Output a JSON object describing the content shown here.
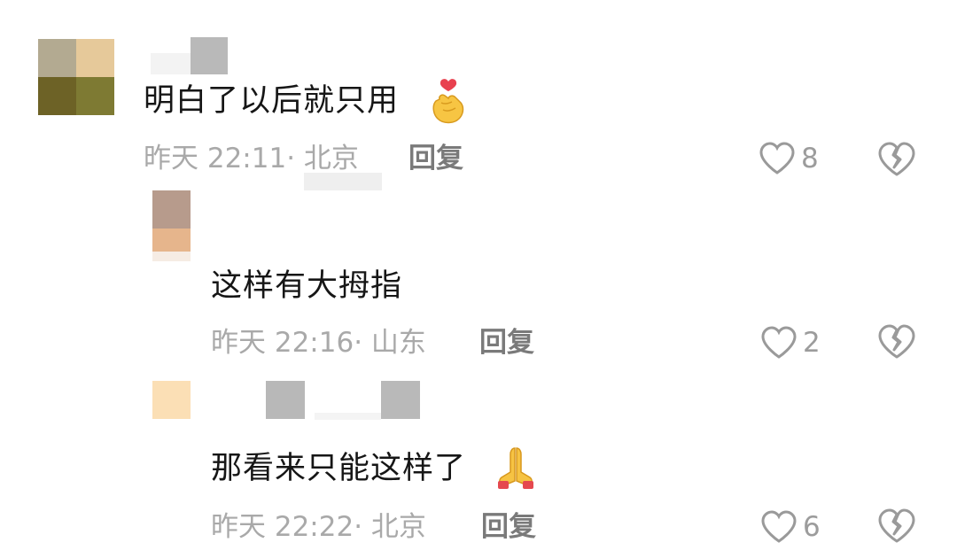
{
  "comments": [
    {
      "text": "明白了以后就只用",
      "emoji_icon": "finger-heart-icon",
      "time": "昨天 22:11",
      "location": "北京",
      "reply_label": "回复",
      "likes": "8",
      "dislike_icon": "broken-heart-icon"
    },
    {
      "text": "这样有大拇指",
      "time": "昨天 22:16",
      "location": "山东",
      "reply_label": "回复",
      "likes": "2",
      "dislike_icon": "broken-heart-icon"
    },
    {
      "text": "那看来只能这样了",
      "emoji_icon": "folded-hands-icon",
      "time": "昨天 22:22",
      "location": "北京",
      "reply_label": "回复",
      "likes": "6",
      "dislike_icon": "broken-heart-icon"
    }
  ],
  "separator": "·",
  "colors": {
    "text": "#161616",
    "meta": "#a9a9a9",
    "reply": "#7a7a7a",
    "icon": "#9a9a9a"
  }
}
